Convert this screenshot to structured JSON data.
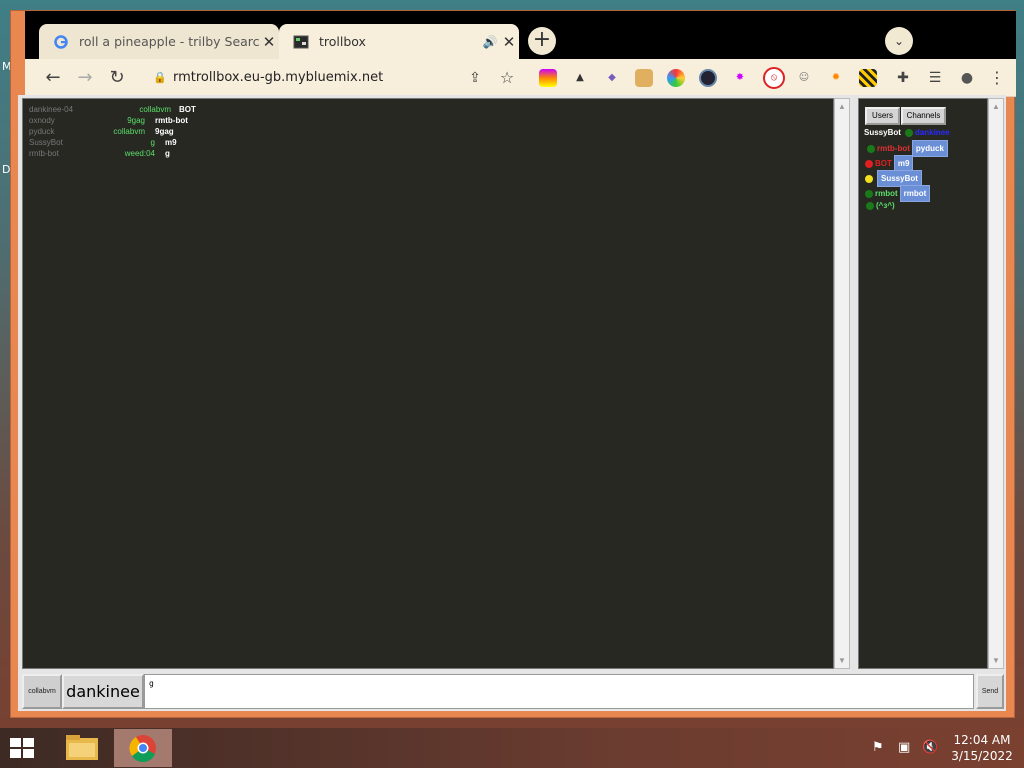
{
  "desktop": {
    "letters": [
      "M",
      "D"
    ]
  },
  "browser": {
    "tabs": [
      {
        "title": "roll a pineapple - trilby Search",
        "icon": "google-icon",
        "active": false
      },
      {
        "title": "trollbox",
        "icon": "trollbox-icon",
        "active": true
      }
    ],
    "new_tab": "+",
    "url": "rmtrollbox.eu-gb.mybluemix.net",
    "extensions": [
      "ext-rainbow",
      "ext-hat",
      "ext-invader",
      "ext-doge",
      "ext-colorwheel",
      "ext-compass",
      "ext-burst",
      "ext-block",
      "ext-face",
      "ext-sun",
      "ext-bee",
      "puzzle-icon",
      "playlist-icon",
      "profile-icon",
      "menu-icon"
    ]
  },
  "chat": {
    "messages": [
      {
        "user": "dankinee-04",
        "nick": "collabvm",
        "text": "BOT",
        "nick_color": "#5bdf6b"
      },
      {
        "user": "oxnody",
        "nick": "9gag",
        "text": "rmtb-bot",
        "nick_color": "#5bdf6b"
      },
      {
        "user": "pyduck",
        "nick": "collabvm",
        "text": "9gag",
        "nick_color": "#5bdf6b"
      },
      {
        "user": "SussyBot",
        "nick": "g",
        "text": "m9",
        "nick_color": "#5bdf6b"
      },
      {
        "user": "rmtb-bot",
        "nick": "weed:04",
        "text": "g",
        "nick_color": "#5bdf6b"
      }
    ]
  },
  "sidebar": {
    "buttons": {
      "users": "Users",
      "channels": "Channels"
    },
    "users": [
      {
        "name": "SussyBot",
        "dot": "#1a7a1a",
        "tag": "",
        "name_color": "#ffffff",
        "after": "dankinee"
      },
      {
        "name": "rmtb-bot",
        "dot": "#1a7a1a",
        "tag": "pyduck",
        "name_color": "#e03030"
      },
      {
        "name": "BOT",
        "dot": "#e02020",
        "tag": "m9",
        "name_color": "#e02020"
      },
      {
        "name": "",
        "dot": "#f0e020",
        "tag": "SussyBot",
        "name_color": "#ffffff"
      },
      {
        "name": "rmbot",
        "dot": "#1a7a1a",
        "tag": "rmbot",
        "name_color": "#5bdf6b"
      },
      {
        "name": "(^з^)",
        "dot": "#1a7a1a",
        "tag": "",
        "name_color": "#5bdf6b"
      }
    ]
  },
  "composer": {
    "room": "collabvm",
    "nick": "dankinee",
    "input_value": "g",
    "send": "Send"
  },
  "taskbar": {
    "time": "12:04 AM",
    "date": "3/15/2022"
  }
}
